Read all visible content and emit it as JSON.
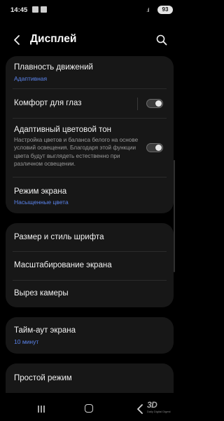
{
  "status_bar": {
    "time": "14:45",
    "battery": "93",
    "icons": [
      "notification-icon",
      "photo-icon",
      "signal-icon",
      "battery-icon"
    ]
  },
  "header": {
    "title": "Дисплей",
    "icons": [
      "back-arrow-icon",
      "search-icon"
    ]
  },
  "group1": [
    {
      "label": "Плавность движений",
      "value": "Адаптивная"
    },
    {
      "label": "Комфорт для глаз",
      "toggle": false
    },
    {
      "label": "Адаптивный цветовой тон",
      "description": "Настройка цветов и баланса белого на основе условий освещения. Благодаря этой функции цвета будут выглядеть естественно при различном освещении.",
      "toggle": false
    },
    {
      "label": "Режим экрана",
      "value": "Насыщенные цвета"
    }
  ],
  "group2": [
    {
      "label": "Размер и стиль шрифта"
    },
    {
      "label": "Масштабирование экрана"
    },
    {
      "label": "Вырез камеры"
    }
  ],
  "group3": [
    {
      "label": "Тайм-аут экрана",
      "value": "10 минут"
    }
  ],
  "group4": [
    {
      "label": "Простой режим"
    }
  ],
  "navbar": {
    "icons": [
      "recent-apps-icon",
      "home-icon",
      "back-icon"
    ]
  },
  "watermark": {
    "logo": "3D",
    "tagline": "Daily Digital Digest"
  },
  "colors": {
    "accent": "#5b84ec",
    "card": "#171717",
    "background": "#000000"
  }
}
